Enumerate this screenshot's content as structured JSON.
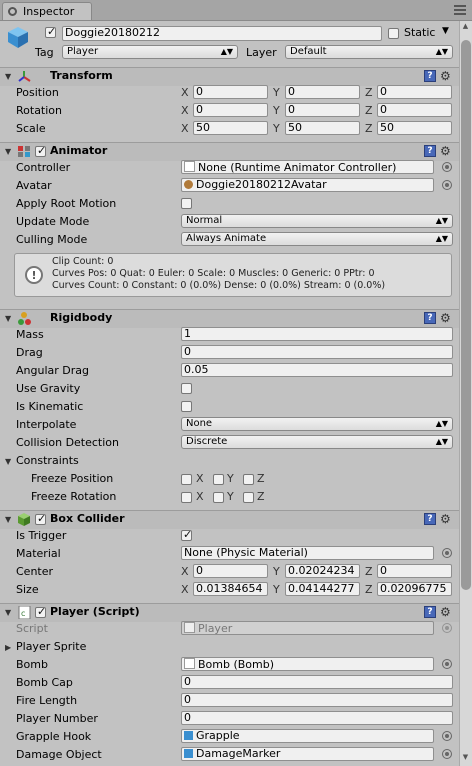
{
  "window": {
    "tab_title": "Inspector"
  },
  "object": {
    "name": "Doggie20180212",
    "active": true,
    "static_label": "Static",
    "tag_label": "Tag",
    "tag_value": "Player",
    "layer_label": "Layer",
    "layer_value": "Default"
  },
  "transform": {
    "title": "Transform",
    "rows": [
      {
        "label": "Position",
        "x": "0",
        "y": "0",
        "z": "0"
      },
      {
        "label": "Rotation",
        "x": "0",
        "y": "0",
        "z": "0"
      },
      {
        "label": "Scale",
        "x": "50",
        "y": "50",
        "z": "50"
      }
    ]
  },
  "axes": {
    "x": "X",
    "y": "Y",
    "z": "Z"
  },
  "animator": {
    "title": "Animator",
    "enabled": true,
    "controller_label": "Controller",
    "controller_value": "None (Runtime Animator Controller)",
    "avatar_label": "Avatar",
    "avatar_value": "Doggie20180212Avatar",
    "apply_root_label": "Apply Root Motion",
    "update_mode_label": "Update Mode",
    "update_mode_value": "Normal",
    "culling_label": "Culling Mode",
    "culling_value": "Always Animate",
    "info": [
      "Clip Count: 0",
      "Curves Pos: 0 Quat: 0 Euler: 0 Scale: 0 Muscles: 0 Generic: 0 PPtr: 0",
      "Curves Count: 0 Constant: 0 (0.0%) Dense: 0 (0.0%) Stream: 0 (0.0%)"
    ]
  },
  "rigidbody": {
    "title": "Rigidbody",
    "mass_label": "Mass",
    "mass": "1",
    "drag_label": "Drag",
    "drag": "0",
    "angular_label": "Angular Drag",
    "angular": "0.05",
    "gravity_label": "Use Gravity",
    "kinematic_label": "Is Kinematic",
    "interpolate_label": "Interpolate",
    "interpolate": "None",
    "collision_label": "Collision Detection",
    "collision": "Discrete",
    "constraints_label": "Constraints",
    "freeze_pos_label": "Freeze Position",
    "freeze_rot_label": "Freeze Rotation"
  },
  "box_collider": {
    "title": "Box Collider",
    "enabled": true,
    "trigger_label": "Is Trigger",
    "material_label": "Material",
    "material_value": "None (Physic Material)",
    "center_label": "Center",
    "center": {
      "x": "0",
      "y": "0.02024234",
      "z": "0"
    },
    "size_label": "Size",
    "size": {
      "x": "0.01384654",
      "y": "0.04144277",
      "z": "0.02096775"
    }
  },
  "player": {
    "title": "Player (Script)",
    "enabled": true,
    "script_label": "Script",
    "script_value": "Player",
    "sprite_label": "Player Sprite",
    "bomb_label": "Bomb",
    "bomb_value": "Bomb (Bomb)",
    "bombcap_label": "Bomb Cap",
    "bombcap": "0",
    "fire_label": "Fire Length",
    "fire": "0",
    "number_label": "Player Number",
    "number": "0",
    "grapple_label": "Grapple Hook",
    "grapple_value": "Grapple",
    "damage_label": "Damage Object",
    "damage_value": "DamageMarker"
  },
  "colors": {
    "help_blue": "#4868b8",
    "panel": "#c2c2c2",
    "header": "#bbbbbb"
  }
}
